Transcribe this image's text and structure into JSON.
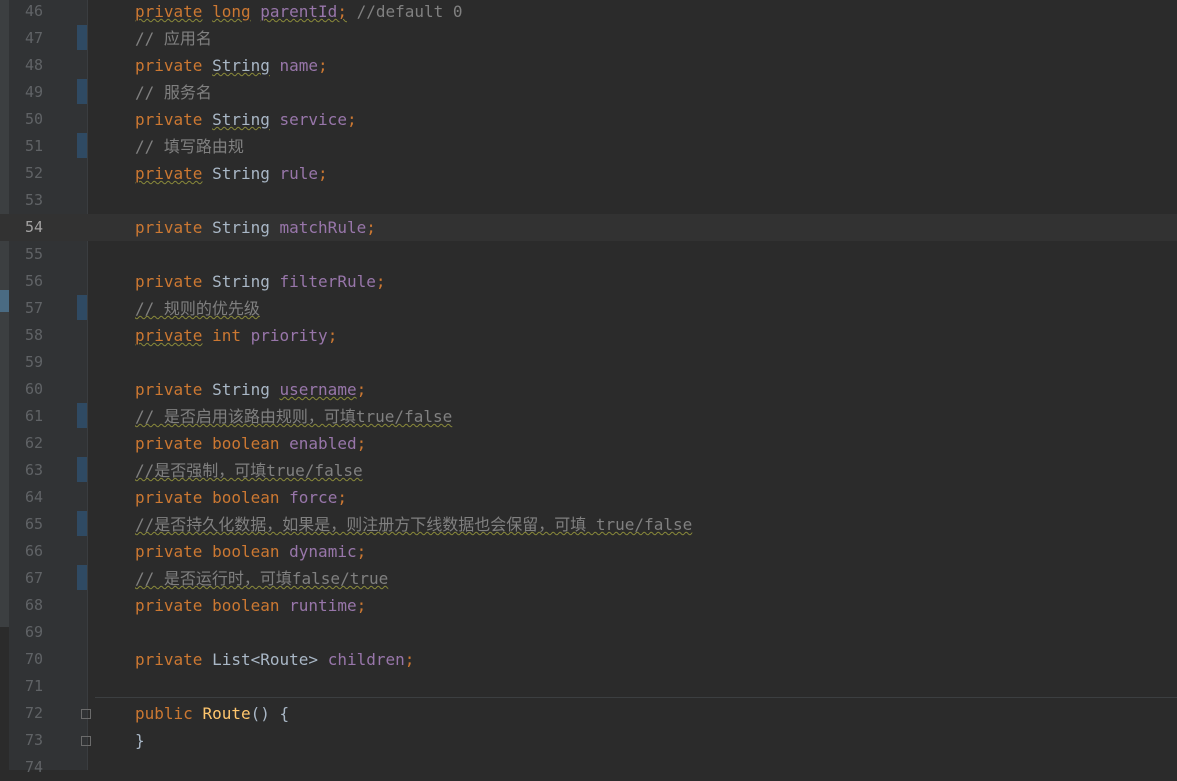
{
  "editor": {
    "lines": [
      {
        "n": "46",
        "tokens": [
          [
            "kw warn",
            "private"
          ],
          [
            "typ",
            " "
          ],
          [
            "kw warn",
            "long"
          ],
          [
            "typ",
            " "
          ],
          [
            "fld warn",
            "parentId"
          ],
          [
            "kw warn",
            ";"
          ],
          [
            "typ",
            " "
          ],
          [
            "cmt",
            "//default 0"
          ]
        ]
      },
      {
        "n": "47",
        "marker": true,
        "tokens": [
          [
            "cmt",
            "// 应用名"
          ]
        ]
      },
      {
        "n": "48",
        "tokens": [
          [
            "kw",
            "private"
          ],
          [
            "typ",
            " "
          ],
          [
            "typ warn",
            "String"
          ],
          [
            "typ",
            " "
          ],
          [
            "fld",
            "name"
          ],
          [
            "kw",
            ";"
          ]
        ]
      },
      {
        "n": "49",
        "marker": true,
        "tokens": [
          [
            "cmt",
            "// 服务名"
          ]
        ]
      },
      {
        "n": "50",
        "tokens": [
          [
            "kw",
            "private"
          ],
          [
            "typ",
            " "
          ],
          [
            "typ warn",
            "String"
          ],
          [
            "typ",
            " "
          ],
          [
            "fld",
            "service"
          ],
          [
            "kw",
            ";"
          ]
        ]
      },
      {
        "n": "51",
        "marker": true,
        "tokens": [
          [
            "cmt",
            "// 填写路由规"
          ]
        ]
      },
      {
        "n": "52",
        "tokens": [
          [
            "kw warn",
            "private"
          ],
          [
            "typ",
            " "
          ],
          [
            "typ",
            "String"
          ],
          [
            "typ",
            " "
          ],
          [
            "fld",
            "rule"
          ],
          [
            "kw",
            ";"
          ]
        ]
      },
      {
        "n": "53",
        "tokens": []
      },
      {
        "n": "54",
        "current": true,
        "tokens": [
          [
            "kw",
            "private"
          ],
          [
            "typ",
            " "
          ],
          [
            "typ",
            "String"
          ],
          [
            "typ",
            " "
          ],
          [
            "fld",
            "matchRule"
          ],
          [
            "kw",
            ";"
          ]
        ]
      },
      {
        "n": "55",
        "tokens": []
      },
      {
        "n": "56",
        "tokens": [
          [
            "kw",
            "private"
          ],
          [
            "typ",
            " "
          ],
          [
            "typ",
            "String"
          ],
          [
            "typ",
            " "
          ],
          [
            "fld",
            "filterRule"
          ],
          [
            "kw",
            ";"
          ]
        ]
      },
      {
        "n": "57",
        "marker": true,
        "tokens": [
          [
            "cmt warn",
            "// 规则的优先级"
          ]
        ]
      },
      {
        "n": "58",
        "tokens": [
          [
            "kw warn",
            "private"
          ],
          [
            "typ",
            " "
          ],
          [
            "kw",
            "int"
          ],
          [
            "typ",
            " "
          ],
          [
            "fld",
            "priority"
          ],
          [
            "kw",
            ";"
          ]
        ]
      },
      {
        "n": "59",
        "tokens": []
      },
      {
        "n": "60",
        "tokens": [
          [
            "kw",
            "private"
          ],
          [
            "typ",
            " "
          ],
          [
            "typ",
            "String"
          ],
          [
            "typ",
            " "
          ],
          [
            "fld warn",
            "username"
          ],
          [
            "kw",
            ";"
          ]
        ]
      },
      {
        "n": "61",
        "marker": true,
        "tokens": [
          [
            "cmt warn",
            "// 是否启用该路由规则，可填true/false"
          ]
        ]
      },
      {
        "n": "62",
        "tokens": [
          [
            "kw",
            "private"
          ],
          [
            "typ",
            " "
          ],
          [
            "kw",
            "boolean"
          ],
          [
            "typ",
            " "
          ],
          [
            "fld",
            "enabled"
          ],
          [
            "kw",
            ";"
          ]
        ]
      },
      {
        "n": "63",
        "marker": true,
        "tokens": [
          [
            "cmt warn",
            "//是否强制，可填true/false"
          ]
        ]
      },
      {
        "n": "64",
        "tokens": [
          [
            "kw",
            "private"
          ],
          [
            "typ",
            " "
          ],
          [
            "kw",
            "boolean"
          ],
          [
            "typ",
            " "
          ],
          [
            "fld",
            "force"
          ],
          [
            "kw",
            ";"
          ]
        ]
      },
      {
        "n": "65",
        "marker": true,
        "tokens": [
          [
            "cmt warn",
            "//是否持久化数据，如果是，则注册方下线数据也会保留，可填 true/false"
          ]
        ]
      },
      {
        "n": "66",
        "tokens": [
          [
            "kw",
            "private"
          ],
          [
            "typ",
            " "
          ],
          [
            "kw",
            "boolean"
          ],
          [
            "typ",
            " "
          ],
          [
            "fld",
            "dynamic"
          ],
          [
            "kw",
            ";"
          ]
        ]
      },
      {
        "n": "67",
        "marker": true,
        "tokens": [
          [
            "cmt warn",
            "// 是否运行时，可填false/true"
          ]
        ]
      },
      {
        "n": "68",
        "tokens": [
          [
            "kw",
            "private"
          ],
          [
            "typ",
            " "
          ],
          [
            "kw",
            "boolean"
          ],
          [
            "typ",
            " "
          ],
          [
            "fld",
            "runtime"
          ],
          [
            "kw",
            ";"
          ]
        ]
      },
      {
        "n": "69",
        "tokens": []
      },
      {
        "n": "70",
        "tokens": [
          [
            "kw",
            "private"
          ],
          [
            "typ",
            " "
          ],
          [
            "typ",
            "List<Route>"
          ],
          [
            "typ",
            " "
          ],
          [
            "fld",
            "children"
          ],
          [
            "kw",
            ";"
          ]
        ]
      },
      {
        "n": "71",
        "tokens": []
      },
      {
        "n": "72",
        "fold": true,
        "tokens": [
          [
            "kw",
            "public"
          ],
          [
            "typ",
            " "
          ],
          [
            "fn",
            "Route"
          ],
          [
            "typ",
            "() {"
          ]
        ]
      },
      {
        "n": "73",
        "fold": true,
        "tokens": [
          [
            "typ",
            "}"
          ]
        ]
      },
      {
        "n": "74",
        "tokens": []
      }
    ]
  },
  "colors": {
    "background": "#2b2b2b",
    "keyword": "#cc7832",
    "field": "#9876aa",
    "comment": "#808080",
    "method": "#ffc66d",
    "text": "#a9b7c6"
  }
}
